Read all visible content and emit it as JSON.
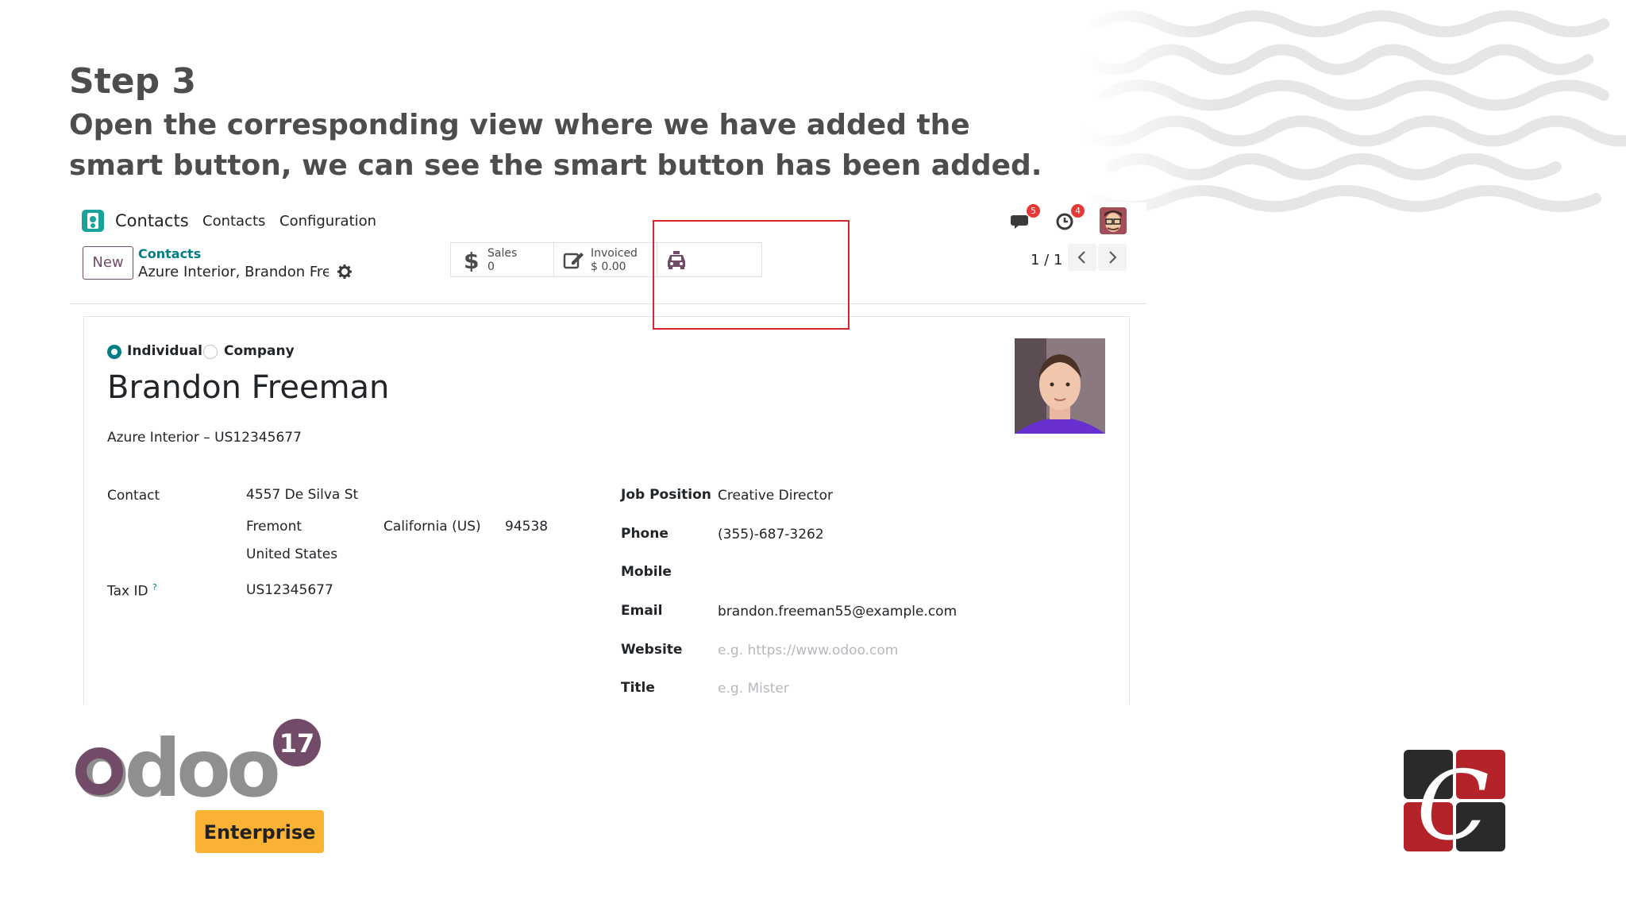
{
  "slide": {
    "step_title": "Step 3",
    "step_description": "Open the corresponding view where we have added the smart button, we can see the smart button has been added."
  },
  "navbar": {
    "app_name": "Contacts",
    "menu": [
      "Contacts",
      "Configuration"
    ],
    "messages_badge": "5",
    "activities_badge": "4"
  },
  "control_panel": {
    "new_button": "New",
    "breadcrumb": "Contacts",
    "record_name": "Azure Interior, Brandon Fre...",
    "smart_buttons": [
      {
        "label": "Sales",
        "value": "0",
        "icon": "dollar-icon"
      },
      {
        "label": "Invoiced",
        "value": "$ 0.00",
        "icon": "edit-icon"
      },
      {
        "label": "",
        "value": "",
        "icon": "taxi-icon"
      }
    ],
    "pager": "1 / 1"
  },
  "form": {
    "type_options": [
      "Individual",
      "Company"
    ],
    "selected_type": "Individual",
    "name": "Brandon Freeman",
    "company_line": "Azure Interior – US12345677",
    "left_fields": {
      "contact_label": "Contact",
      "street": "4557 De Silva St",
      "city": "Fremont",
      "state": "California (US)",
      "zip": "94538",
      "country": "United States",
      "tax_id_label": "Tax ID",
      "tax_id_help": "?",
      "tax_id": "US12345677"
    },
    "right_fields": {
      "job_position_label": "Job Position",
      "job_position": "Creative Director",
      "phone_label": "Phone",
      "phone": "(355)-687-3262",
      "mobile_label": "Mobile",
      "email_label": "Email",
      "email": "brandon.freeman55@example.com",
      "website_label": "Website",
      "website_placeholder": "e.g. https://www.odoo.com",
      "title_label": "Title",
      "title_placeholder": "e.g. Mister"
    }
  },
  "branding": {
    "odoo_wordmark": "odoo",
    "odoo_version": "17",
    "edition": "Enterprise",
    "partner_logo_letter": "C"
  },
  "colors": {
    "odoo_purple": "#714b67",
    "teal": "#017e84",
    "highlight_red": "#d7262b",
    "enterprise_orange": "#f9b233"
  }
}
